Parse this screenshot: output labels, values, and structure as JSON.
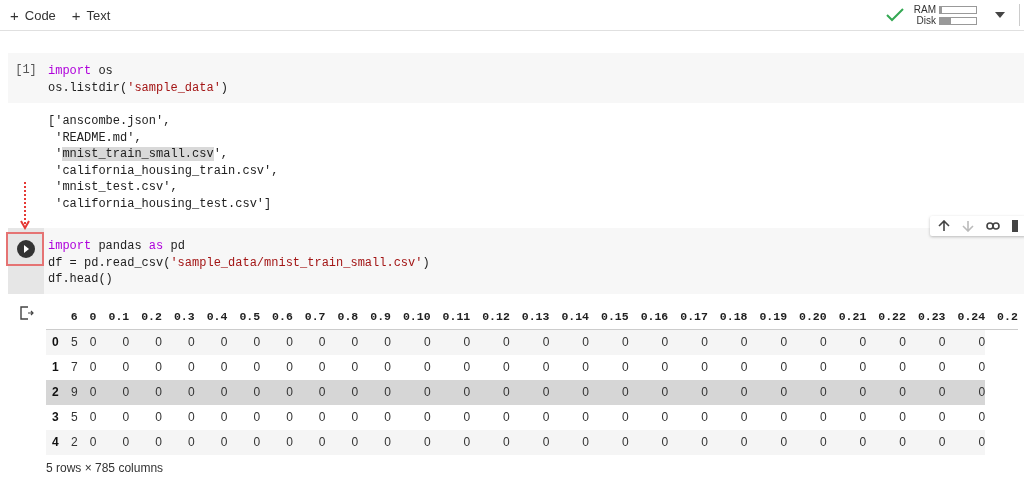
{
  "toolbar": {
    "add_code": {
      "icon": "+",
      "label": "Code"
    },
    "add_text": {
      "icon": "+",
      "label": "Text"
    },
    "ram": {
      "label": "RAM",
      "level": 0.06
    },
    "disk": {
      "label": "Disk",
      "level": 0.3
    }
  },
  "cells": [
    {
      "prompt": "[1]",
      "run_button": false,
      "code": [
        [
          {
            "kind": "keyword",
            "text": "import"
          },
          {
            "kind": "plain",
            "text": " os"
          }
        ],
        [
          {
            "kind": "plain",
            "text": "os.listdir("
          },
          {
            "kind": "string",
            "text": "'sample_data'"
          },
          {
            "kind": "plain",
            "text": ")"
          }
        ]
      ],
      "output": {
        "kind": "text",
        "lines": [
          [
            {
              "text": "['anscombe.json',",
              "highlighted": false
            }
          ],
          [
            {
              "text": " 'README.md',",
              "highlighted": false
            }
          ],
          [
            {
              "text": " '",
              "highlighted": false
            },
            {
              "text": "mnist_train_small.csv",
              "highlighted": true
            },
            {
              "text": "',",
              "highlighted": false
            }
          ],
          [
            {
              "text": " 'california_housing_train.csv',",
              "highlighted": false
            }
          ],
          [
            {
              "text": " 'mnist_test.csv',",
              "highlighted": false
            }
          ],
          [
            {
              "text": " 'california_housing_test.csv']",
              "highlighted": false
            }
          ]
        ]
      }
    },
    {
      "run_button": true,
      "code": [
        [
          {
            "kind": "keyword",
            "text": "import"
          },
          {
            "kind": "plain",
            "text": " pandas "
          },
          {
            "kind": "keyword",
            "text": "as"
          },
          {
            "kind": "plain",
            "text": " pd"
          }
        ],
        [
          {
            "kind": "plain",
            "text": "df = pd.read_csv("
          },
          {
            "kind": "string",
            "text": "'sample_data/mnist_train_small.csv'"
          },
          {
            "kind": "plain",
            "text": ")"
          }
        ],
        [
          {
            "kind": "plain",
            "text": "df.head()"
          }
        ]
      ],
      "output": {
        "kind": "table",
        "columns": [
          "6",
          "0",
          "0.1",
          "0.2",
          "0.3",
          "0.4",
          "0.5",
          "0.6",
          "0.7",
          "0.8",
          "0.9",
          "0.10",
          "0.11",
          "0.12",
          "0.13",
          "0.14",
          "0.15",
          "0.16",
          "0.17",
          "0.18",
          "0.19",
          "0.20",
          "0.21",
          "0.22",
          "0.23",
          "0.24",
          "0.2"
        ],
        "rows": [
          {
            "index": "0",
            "highlighted": false,
            "cells": [
              "5",
              "0",
              "0",
              "0",
              "0",
              "0",
              "0",
              "0",
              "0",
              "0",
              "0",
              "0",
              "0",
              "0",
              "0",
              "0",
              "0",
              "0",
              "0",
              "0",
              "0",
              "0",
              "0",
              "0",
              "0",
              "0"
            ]
          },
          {
            "index": "1",
            "highlighted": false,
            "cells": [
              "7",
              "0",
              "0",
              "0",
              "0",
              "0",
              "0",
              "0",
              "0",
              "0",
              "0",
              "0",
              "0",
              "0",
              "0",
              "0",
              "0",
              "0",
              "0",
              "0",
              "0",
              "0",
              "0",
              "0",
              "0",
              "0"
            ]
          },
          {
            "index": "2",
            "highlighted": true,
            "cells": [
              "9",
              "0",
              "0",
              "0",
              "0",
              "0",
              "0",
              "0",
              "0",
              "0",
              "0",
              "0",
              "0",
              "0",
              "0",
              "0",
              "0",
              "0",
              "0",
              "0",
              "0",
              "0",
              "0",
              "0",
              "0",
              "0"
            ]
          },
          {
            "index": "3",
            "highlighted": false,
            "cells": [
              "5",
              "0",
              "0",
              "0",
              "0",
              "0",
              "0",
              "0",
              "0",
              "0",
              "0",
              "0",
              "0",
              "0",
              "0",
              "0",
              "0",
              "0",
              "0",
              "0",
              "0",
              "0",
              "0",
              "0",
              "0",
              "0"
            ]
          },
          {
            "index": "4",
            "highlighted": false,
            "cells": [
              "2",
              "0",
              "0",
              "0",
              "0",
              "0",
              "0",
              "0",
              "0",
              "0",
              "0",
              "0",
              "0",
              "0",
              "0",
              "0",
              "0",
              "0",
              "0",
              "0",
              "0",
              "0",
              "0",
              "0",
              "0",
              "0"
            ]
          }
        ],
        "footer": "5 rows × 785 columns"
      }
    }
  ]
}
